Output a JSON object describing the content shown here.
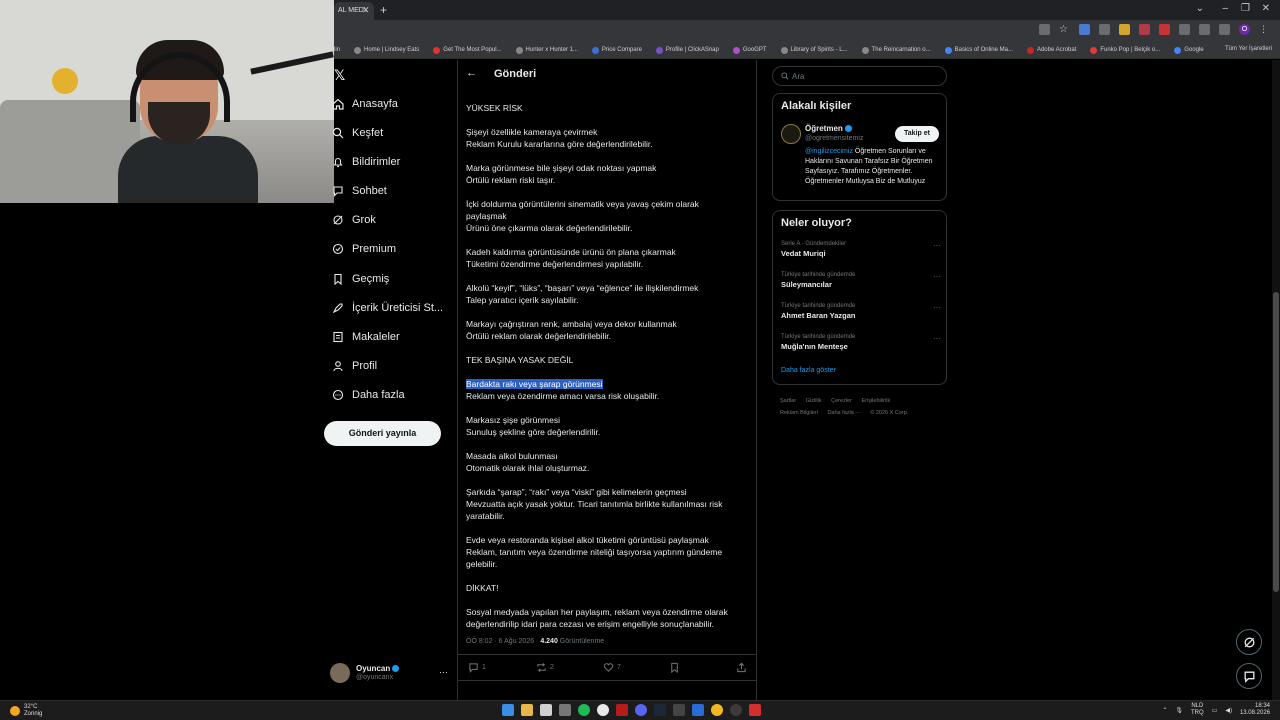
{
  "browser": {
    "tab_title": "AL MEDY",
    "bookmarks": [
      "lin",
      "Home | Lindsey Eats",
      "Get The Most Popul...",
      "Hunter x Hunter 1...",
      "Price Compare",
      "Profile | ClickASnap",
      "GooGPT",
      "Library of Spirits - L...",
      "The Reincarnation o...",
      "Basics of Online Ma...",
      "Adobe Acrobat",
      "Funko Pop | Belçik o...",
      "Google"
    ],
    "bookmarks_right": "Tüm Yer İşaretleri",
    "profile_letter": "O"
  },
  "nav": {
    "items": [
      {
        "label": "Anasayfa",
        "icon": "home-icon"
      },
      {
        "label": "Keşfet",
        "icon": "search-icon"
      },
      {
        "label": "Bildirimler",
        "icon": "bell-icon"
      },
      {
        "label": "Sohbet",
        "icon": "chat-icon"
      },
      {
        "label": "Grok",
        "icon": "grok-icon"
      },
      {
        "label": "Premium",
        "icon": "premium-icon"
      },
      {
        "label": "Geçmiş",
        "icon": "bookmark-icon"
      },
      {
        "label": "İçerik Üreticisi St...",
        "icon": "rocket-icon"
      },
      {
        "label": "Makaleler",
        "icon": "article-icon"
      },
      {
        "label": "Profil",
        "icon": "person-icon"
      },
      {
        "label": "Daha fazla",
        "icon": "more-icon"
      }
    ],
    "post_button": "Gönderi yayınla",
    "user_name": "Oyuncan",
    "user_handle": "@oyuncanx",
    "user_more": "···"
  },
  "post": {
    "back": "←",
    "header": "Gönderi",
    "lines": [
      "YÜKSEK RİSK",
      "Şişeyi özellikle kameraya çevirmek",
      "Reklam Kurulu kararlarına göre değerlendirilebilir.",
      "Marka görünmese bile şişeyi odak noktası yapmak",
      "Örtülü reklam riski taşır.",
      "İçki doldurma görüntülerini sinematik veya yavaş çekim olarak",
      "paylaşmak",
      "Ürünü öne çıkarma olarak değerlendirilebilir.",
      "Kadeh kaldırma görüntüsünde ürünü ön plana çıkarmak",
      "Tüketimi özendirme değerlendirmesi yapılabilir.",
      "Alkolü “keyif”, “lüks”, “başarı” veya “eğlence” ile ilişkilendirmek",
      "Talep yaratıcı içerik sayılabilir.",
      "Markayı çağrıştıran renk, ambalaj veya dekor kullanmak",
      "Örtülü reklam olarak değerlendirilebilir.",
      "TEK BAŞINA YASAK DEĞİL",
      "B",
      "ardakta rakı veya şarap görünmesi",
      "Reklam veya özendirme amacı varsa risk oluşabilir.",
      "Markasız şişe görünmesi",
      "Sunuluş şekline göre değerlendirilir.",
      "Masada alkol bulunması",
      "Otomatik olarak ihlal oluşturmaz.",
      "Şarkıda “şarap”, “rakı” veya “viski” gibi kelimelerin geçmesi",
      "Mevzuatta açık yasak yoktur. Ticari tanıtımla birlikte kullanılması risk",
      "yaratabilir.",
      "Evde veya restoranda kişisel alkol tüketimi görüntüsü paylaşmak",
      "Reklam, tanıtım veya özendirme niteliği taşıyorsa yaptırım gündeme",
      "gelebilir.",
      "DİKKAT!",
      "Sosyal medyada yapılan her paylaşım, reklam veya özendirme olarak",
      "değerlendirilip idari para cezası ve erişim engelliyle sonuçlanabilir."
    ],
    "meta_time": "ÖÖ 8:02 · 6 Ağu 2026 · ",
    "meta_views": "4.240",
    "meta_views_label": " Görüntülenme",
    "replies": "1",
    "reposts": "2",
    "likes": "7"
  },
  "sidebar": {
    "search_placeholder": "Ara",
    "related_title": "Alakalı kişiler",
    "related_name": "Öğretmen",
    "related_handle": "@ogretmensitemiz",
    "follow_label": "Takip et",
    "bio_mention": "@ingilizcecimiz",
    "bio_rest": " Öğretmen Sorunları ve Haklarını Savunan Tarafsız Bir Öğretmen Sayfasıyız. Tarafımız Öğretmenler. Öğretmenler Mutluysa Biz de Mutluyuz",
    "trends_title": "Neler oluyor?",
    "trends": [
      {
        "context": "Serie A · Gündemdekiler",
        "name": "Vedat Muriqi"
      },
      {
        "context": "Türkiye tarihinde gündemde",
        "name": "Süleymancılar"
      },
      {
        "context": "Türkiye tarihinde gündemde",
        "name": "Ahmet Baran Yazgan"
      },
      {
        "context": "Türkiye tarihinde gündemde",
        "name": "Muğla'nın Menteşe"
      }
    ],
    "trend_more": "···",
    "show_more": "Daha fazla göster",
    "footer": [
      "Şartlar",
      "Gizlilik",
      "Çerezler",
      "Erişilebilirlik",
      "Reklam Bilgileri",
      "Daha fazla ···",
      "© 2026 X Corp."
    ]
  },
  "taskbar": {
    "temp": "32°C",
    "condition": "Zonnig",
    "lang_top": "NLD",
    "lang_bottom": "TRQ",
    "time": "18:34",
    "date": "13.08.2026"
  },
  "colors": {
    "accent": "#1d9bf0",
    "highlight": "#2b5fc2",
    "background": "#000000",
    "text": "#e7e9ea",
    "muted": "#71767b"
  }
}
